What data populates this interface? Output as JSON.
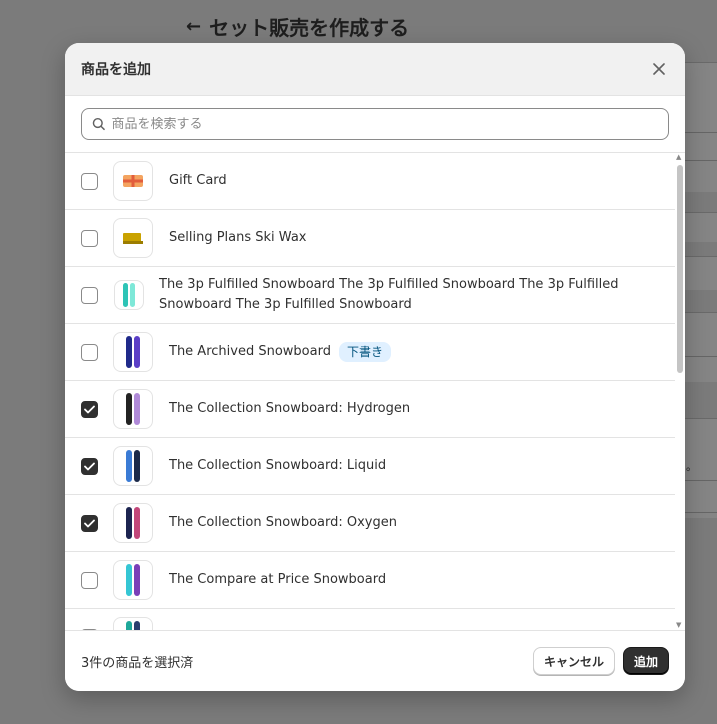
{
  "background": {
    "page_title": "セット販売を作成する"
  },
  "modal": {
    "title": "商品を追加",
    "search": {
      "placeholder": "商品を検索する",
      "value": ""
    },
    "products": [
      {
        "name": "Gift Card",
        "checked": false,
        "thumb": "gift-card"
      },
      {
        "name": "Selling Plans Ski Wax",
        "checked": false,
        "thumb": "ski-wax"
      },
      {
        "name": "The 3p Fulfilled Snowboard The 3p Fulfilled Snowboard The 3p Fulfilled Snowboard The 3p Fulfilled Snowboard",
        "checked": false,
        "thumb": "snowboard-teal"
      },
      {
        "name": "The Archived Snowboard",
        "checked": false,
        "thumb": "snowboard-blue",
        "badge": "下書き"
      },
      {
        "name": "The Collection Snowboard: Hydrogen",
        "checked": true,
        "thumb": "snowboard-black-purple"
      },
      {
        "name": "The Collection Snowboard: Liquid",
        "checked": true,
        "thumb": "snowboard-blue-navy"
      },
      {
        "name": "The Collection Snowboard: Oxygen",
        "checked": true,
        "thumb": "snowboard-navy-pink"
      },
      {
        "name": "The Compare at Price Snowboard",
        "checked": false,
        "thumb": "snowboard-teal-purple"
      }
    ],
    "footer": {
      "selected_count": "3件の商品を選択済",
      "cancel_label": "キャンセル",
      "add_label": "追加"
    }
  },
  "colors": {
    "primary_button": "#303030",
    "badge_bg": "#e0f0ff",
    "badge_text": "#00527c"
  }
}
